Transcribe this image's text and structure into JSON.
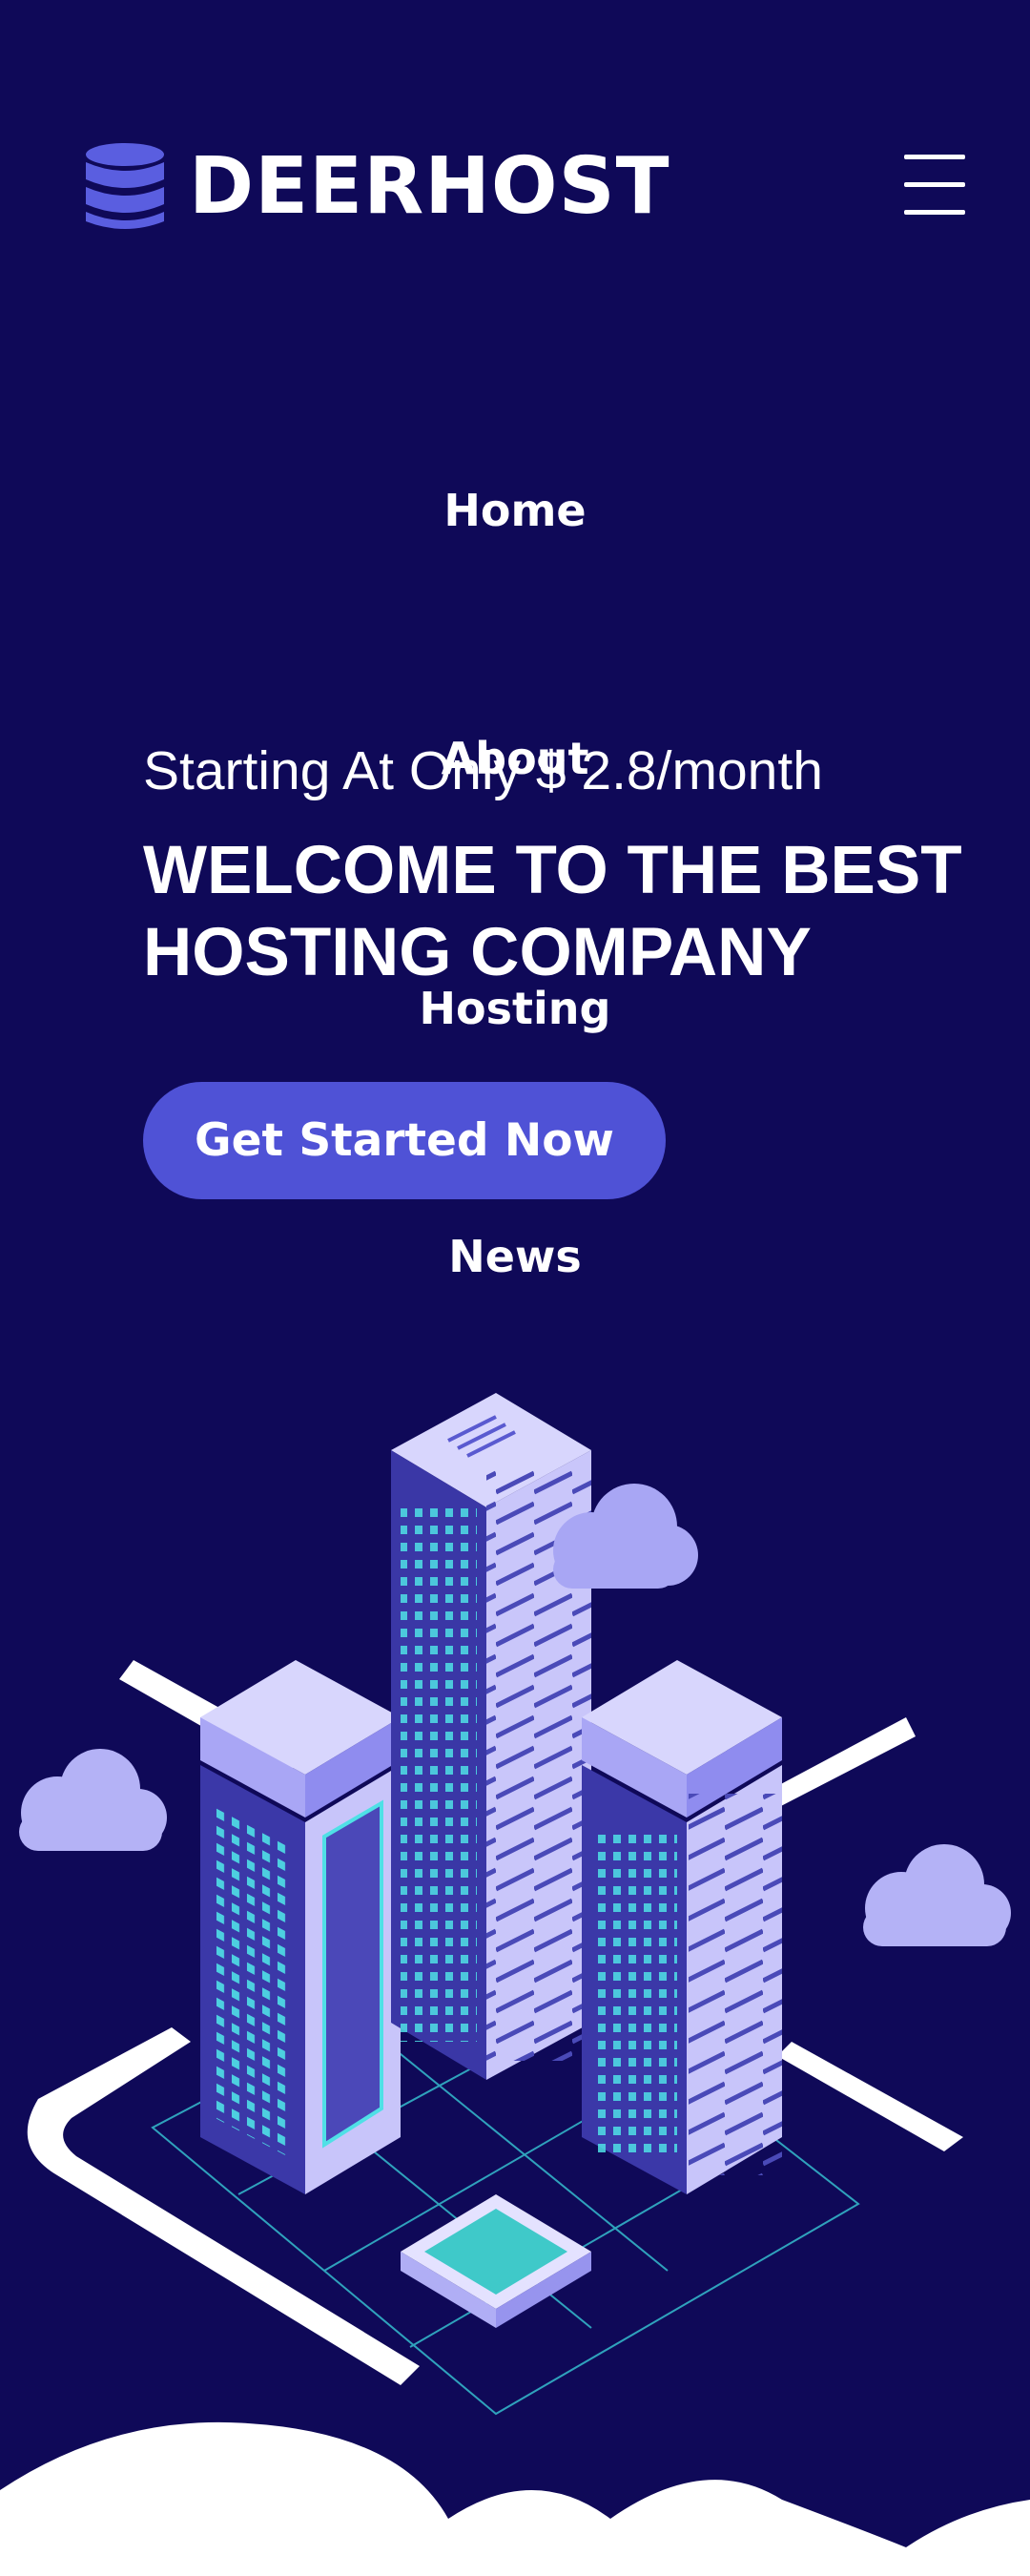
{
  "header": {
    "brand": "DEERHOST",
    "logo_icon": "database-icon",
    "menu_icon": "hamburger-menu-icon"
  },
  "nav": {
    "items": [
      {
        "label": "Home"
      },
      {
        "label": "About"
      },
      {
        "label": "Hosting"
      },
      {
        "label": "News"
      }
    ]
  },
  "hero": {
    "tagline": "Starting At Only $ 2.8/month",
    "headline_line1": "WELCOME TO THE BEST",
    "headline_line2": "HOSTING COMPANY",
    "cta_label": "Get Started Now"
  },
  "illustration": {
    "subject": "isometric-server-buildings-illustration"
  },
  "colors": {
    "background": "#0f0958",
    "accent": "#4f52d6",
    "text": "#ffffff",
    "building_light": "#c9c7fb",
    "building_dark": "#3a3ab0",
    "window_cyan": "#4fe0e6"
  }
}
